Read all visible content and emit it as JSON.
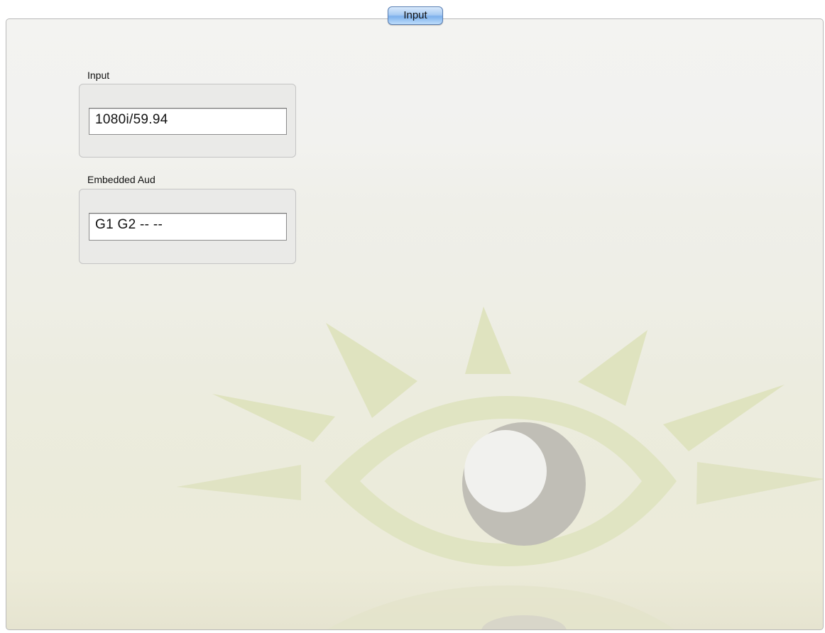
{
  "tab": {
    "label": "Input"
  },
  "groups": [
    {
      "label": "Input",
      "value": "1080i/59.94"
    },
    {
      "label": "Embedded Aud",
      "value": "G1 G2 -- --"
    }
  ],
  "watermark": {
    "icon": "eye-logo-icon",
    "rays_color": "#dfe3bf",
    "iris_color": "#c0beb6"
  }
}
